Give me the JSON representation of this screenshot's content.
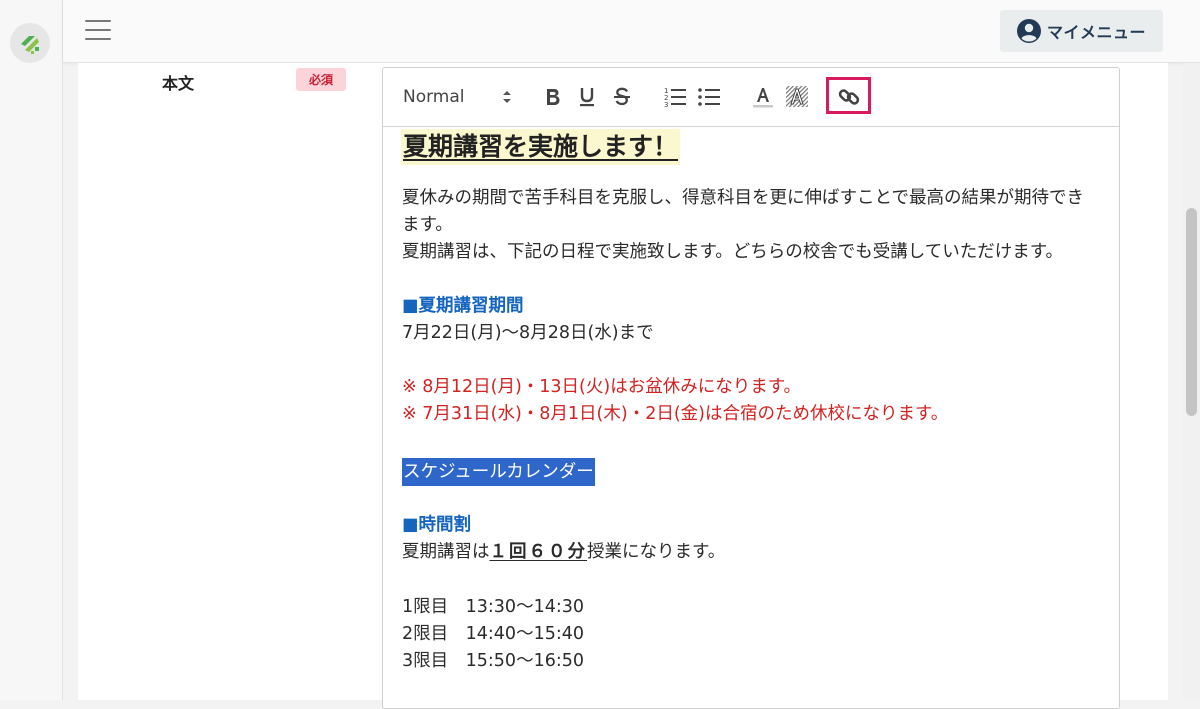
{
  "topbar": {
    "my_menu_label": "マイメニュー"
  },
  "form": {
    "field_label": "本文",
    "required_badge": "必須"
  },
  "editor": {
    "toolbar": {
      "format_value": "Normal"
    },
    "content": {
      "title": "夏期講習を実施します！",
      "para1_line1": "夏休みの期間で苦手科目を克服し、得意科目を更に伸ばすことで最高の結果が期待でき",
      "para1_line2": "ます。",
      "para2": "夏期講習は、下記の日程で実施致します。どちらの校舎でも受講していただけます。",
      "period_heading": "■夏期講習期間",
      "period_text": "7月22日(月)～8月28日(水)まで",
      "note1": "※ 8月12日(月)・13日(火)はお盆休みになります。",
      "note2": "※ 7月31日(水)・8月1日(木)・2日(金)は合宿のため休校になります。",
      "selected_text": "スケジュールカレンダー",
      "timetable_heading": "■時間割",
      "timetable_pre": "夏期講習は",
      "timetable_emph": "１回６０分",
      "timetable_post": "授業になります。",
      "periods": [
        "1限目　13:30～14:30",
        "2限目　14:40～15:40",
        "3限目　15:50～16:50"
      ]
    }
  },
  "colors": {
    "accent_pink": "#d81b5f",
    "heading_blue": "#1565c0",
    "note_red": "#d32222",
    "selection_blue": "#2f66c9",
    "title_highlight": "#fbf7cf"
  },
  "icons": {
    "logo": "app-logo-icon",
    "menu": "hamburger-icon",
    "user": "user-circle-icon",
    "link": "link-icon"
  }
}
